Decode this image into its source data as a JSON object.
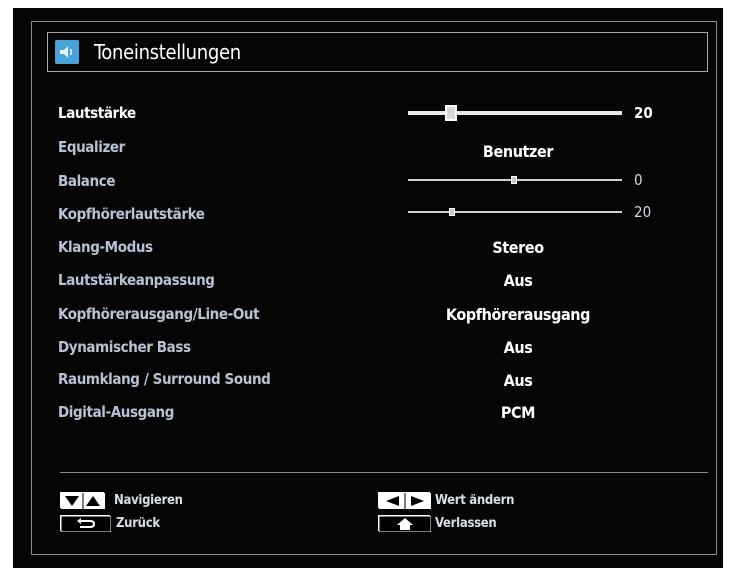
{
  "menu": {
    "title": "Toneinstellungen",
    "icon": "sound-settings-icon"
  },
  "settings": [
    {
      "label": "Lautstärke",
      "type": "slider",
      "level": 20
    },
    {
      "label": "Equalizer",
      "type": "value",
      "value": "Benutzer"
    },
    {
      "label": "Balance",
      "type": "slider",
      "level": 0
    },
    {
      "label": "Kopfhörerlautstärke",
      "type": "slider",
      "level": 20
    },
    {
      "label": "Klang-Modus",
      "type": "value",
      "value": "Stereo"
    },
    {
      "label": "Lautstärkeanpassung",
      "type": "value",
      "value": "Aus"
    },
    {
      "label": "Kopfhörerausgang/Line-Out",
      "type": "value",
      "value": "Kopfhörerausgang"
    },
    {
      "label": "Dynamischer Bass",
      "type": "value",
      "value": "Aus"
    },
    {
      "label": "Raumklang / Surround Sound",
      "type": "value",
      "value": "Aus"
    },
    {
      "label": "Digital-Ausgang",
      "type": "value",
      "value": "PCM"
    }
  ],
  "footer": {
    "navigate": "Navigieren",
    "back": "Zurück",
    "change_value": "Wert ändern",
    "exit": "Verlassen"
  },
  "colors": {
    "background": "#050505",
    "accent": "#4aa3d8",
    "text": "#ffffff"
  }
}
